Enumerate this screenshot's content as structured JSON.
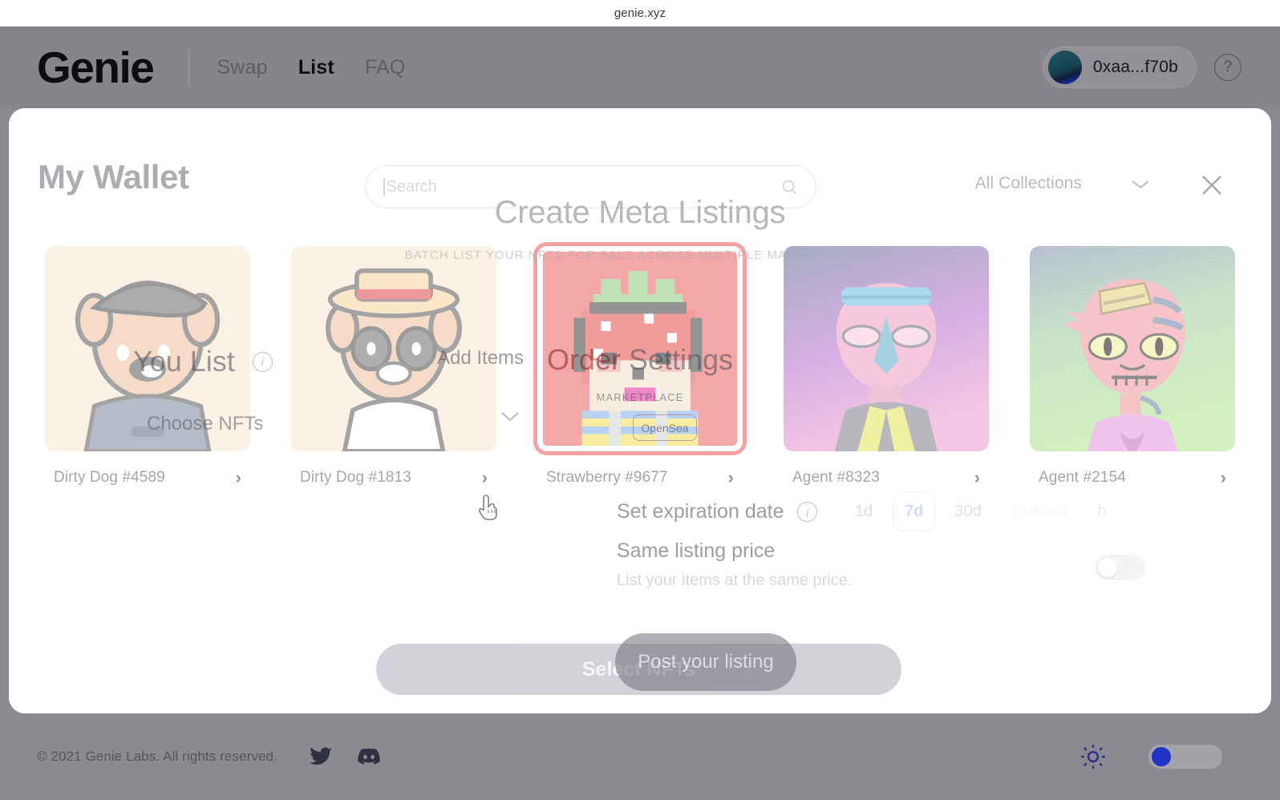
{
  "browser": {
    "title": "genie.xyz"
  },
  "header": {
    "brand": "Genie",
    "nav": [
      {
        "label": "Swap",
        "active": false
      },
      {
        "label": "List",
        "active": true
      },
      {
        "label": "FAQ",
        "active": false
      }
    ],
    "wallet_address": "0xaa...f70b",
    "help_label": "?"
  },
  "wallet_modal": {
    "title": "My Wallet",
    "search_placeholder": "Search",
    "search_value": "",
    "collections_filter": "All Collections",
    "nfts": [
      {
        "name": "Dirty Dog #4589",
        "selected": false,
        "arrow": "›"
      },
      {
        "name": "Dirty Dog #1813",
        "selected": false,
        "arrow": "›"
      },
      {
        "name": "Strawberry #9677",
        "selected": true,
        "arrow": "›"
      },
      {
        "name": "Agent #8323",
        "selected": false,
        "arrow": "›"
      },
      {
        "name": "Agent #2154",
        "selected": false,
        "arrow": "›"
      }
    ],
    "primary_button": "Select NFTs"
  },
  "listing_flow": {
    "title": "Create Meta Listings",
    "subtitle": "BATCH LIST YOUR NFTS FOR SALE ACROSS MULTIPLE MARKETPLACES",
    "step_you_list": "You List",
    "choose_nfts": "Choose NFTs",
    "add_items": "Add Items",
    "step_order_settings_a": "Order",
    "step_order_settings_b": " Settings",
    "marketplace_label": "MARKETPLACE",
    "marketplace_option": "OpenSea",
    "expiration_label": "Set expiration date",
    "expiration_options": [
      {
        "label": "1d",
        "active": false
      },
      {
        "label": "7d",
        "active": true
      },
      {
        "label": "30d",
        "active": false
      },
      {
        "label": "Custom",
        "active": false
      },
      {
        "label": "h",
        "active": false
      }
    ],
    "same_price_title": "Same listing price",
    "same_price_desc": "List your items at the same price.",
    "same_price_enabled": false,
    "primary_button": "Post your listing"
  },
  "footer": {
    "copyright": "© 2021 Genie Labs. All rights reserved.",
    "social": [
      "twitter-icon",
      "discord-icon"
    ],
    "theme_icon": "sun-icon",
    "theme_enabled": true
  },
  "colors": {
    "page_grey": "#8a8a90",
    "header_grey": "#85858b",
    "accent_red": "#ef6a6d",
    "accent_periwinkle": "#b4bdf0",
    "toggle_blue": "#2233c8"
  }
}
